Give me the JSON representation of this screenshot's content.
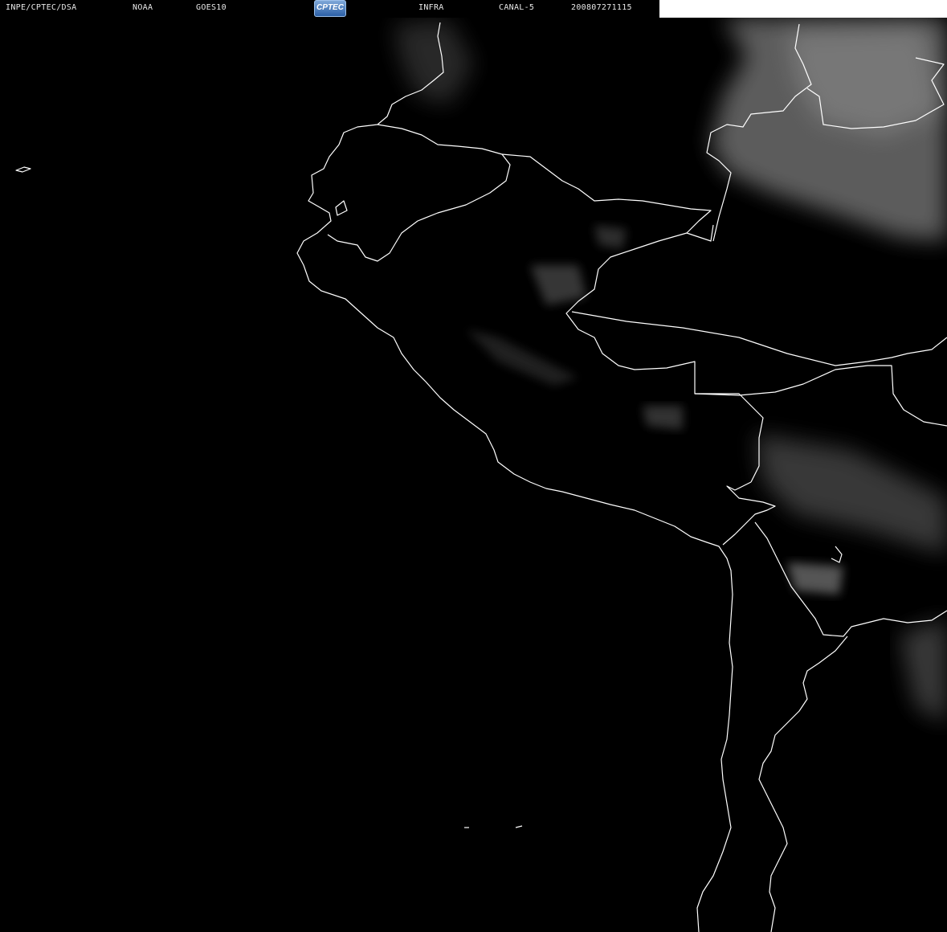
{
  "header": {
    "source": "INPE/CPTEC/DSA",
    "agency": "NOAA",
    "satellite": "GOES10",
    "logo_text": "CPTEC",
    "product": "INFRA",
    "channel": "CANAL-5",
    "timestamp": "200807271115"
  },
  "colors": {
    "background": "#000000",
    "borders": "#ffffff",
    "clouds": "#6e6e6e",
    "logo": "#2b5fa6"
  }
}
